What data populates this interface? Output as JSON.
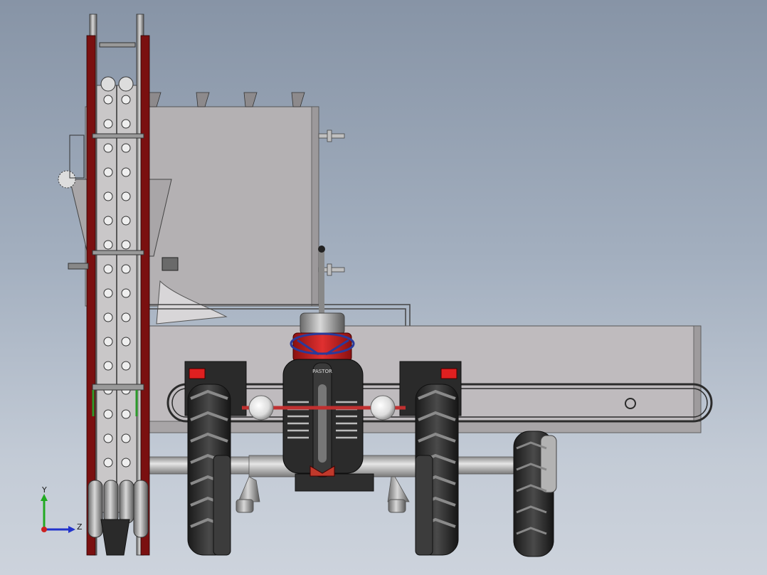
{
  "viewport": {
    "grille_text": "PASTOR",
    "background_top": "#8794a6",
    "background_bottom": "#cdd3dc"
  },
  "triad": {
    "y_label": "Y",
    "z_label": "Z",
    "y_color": "#22aa22",
    "z_color": "#2233cc",
    "x_color": "#cc2222"
  },
  "icons": {
    "triad": "coordinate-axes-icon"
  }
}
